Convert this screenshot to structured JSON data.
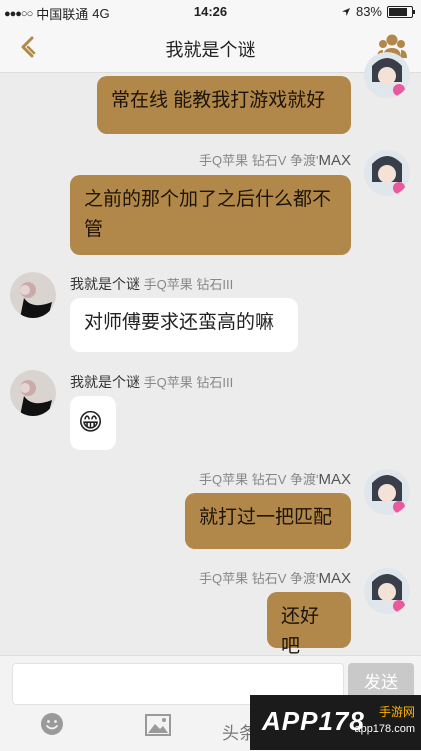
{
  "status_bar": {
    "carrier": "中国联通",
    "network": "4G",
    "time": "14:26",
    "battery": "83%",
    "battery_level": 0.83
  },
  "nav": {
    "title": "我就是个谜",
    "back_icon": "chevron-left-icon",
    "group_icon": "group-members-icon"
  },
  "messages": [
    {
      "side": "right",
      "text": "常在线 能教我打游戏就好"
    },
    {
      "side": "right",
      "meta": "手Q苹果 钻石V 争渡'",
      "name": "MAX",
      "text": "之前的那个加了之后什么都不管"
    },
    {
      "side": "left",
      "name": "我就是个谜",
      "meta": "手Q苹果 钻石III",
      "text": "对师傅要求还蛮高的嘛"
    },
    {
      "side": "left",
      "name": "我就是个谜",
      "meta": "手Q苹果 钻石III",
      "emoji": "😁"
    },
    {
      "side": "right",
      "meta": "手Q苹果 钻石V 争渡'",
      "name": "MAX",
      "text": "就打过一把匹配"
    },
    {
      "side": "right",
      "meta": "手Q苹果 钻石V 争渡'",
      "name": "MAX",
      "text": "还好吧"
    }
  ],
  "input": {
    "placeholder": "",
    "send_label": "发送"
  },
  "toolbar": {
    "emoji_icon": "smiley-icon",
    "image_icon": "image-icon",
    "watermark_prefix": "头条"
  },
  "logo": {
    "brand": "APP178",
    "cn": "手游网",
    "domain": "app178.com"
  },
  "colors": {
    "accent": "#b1884a",
    "background": "#ececec",
    "bubble_in": "#ffffff"
  }
}
